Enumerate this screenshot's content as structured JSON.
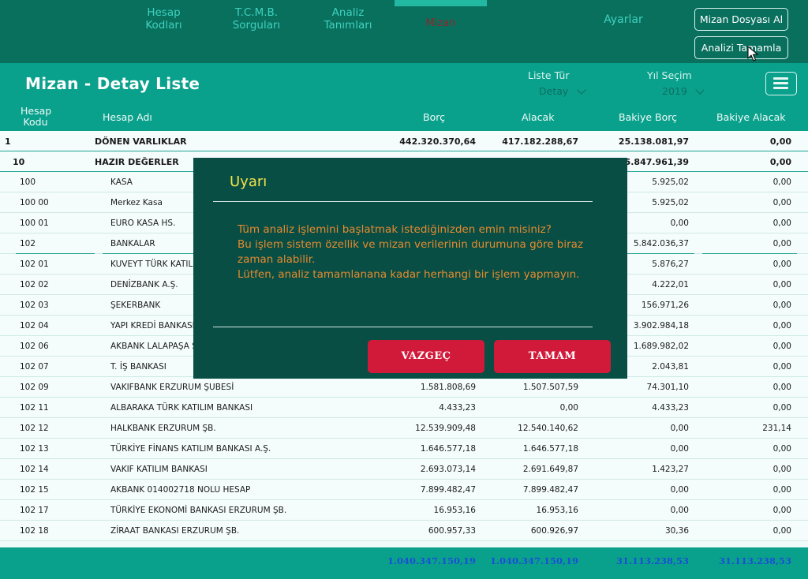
{
  "nav": {
    "items": [
      {
        "label_line1": "Hesap",
        "label_line2": "Kodları"
      },
      {
        "label_line1": "T.C.M.B.",
        "label_line2": "Sorguları"
      },
      {
        "label_line1": "Analiz",
        "label_line2": "Tanımları"
      }
    ],
    "active": "Mizan",
    "settings": "Ayarlar",
    "upload_button": "Mizan Dosyası Al",
    "complete_button": "Analizi Tamamla"
  },
  "header": {
    "title": "Mizan - Detay Liste",
    "list_type_label": "Liste Tür",
    "list_type_value": "Detay",
    "year_label": "Yıl Seçim",
    "year_value": "2019"
  },
  "columns": {
    "code": "Hesap Kodu",
    "code_l1": "Hesap",
    "code_l2": "Kodu",
    "name": "Hesap Adı",
    "debit": "Borç",
    "credit": "Alacak",
    "bal_debit": "Bakiye Borç",
    "bal_credit": "Bakiye Alacak"
  },
  "rows": [
    {
      "code": "1",
      "name": "DÖNEN VARLIKLAR",
      "debit": "442.320.370,64",
      "credit": "417.182.288,67",
      "bal_debit": "25.138.081,97",
      "bal_credit": "0,00",
      "level": 1
    },
    {
      "code": "10",
      "name": "HAZIR DEĞERLER",
      "debit": "",
      "credit": "",
      "bal_debit": "5.847.961,39",
      "bal_credit": "0,00",
      "level": 2
    },
    {
      "code": "100",
      "name": "KASA",
      "debit": "",
      "credit": "",
      "bal_debit": "5.925,02",
      "bal_credit": "0,00",
      "level": 3
    },
    {
      "code": "100 00",
      "name": "Merkez Kasa",
      "debit": "",
      "credit": "",
      "bal_debit": "5.925,02",
      "bal_credit": "0,00",
      "level": 3
    },
    {
      "code": "100 01",
      "name": "EURO KASA HS.",
      "debit": "",
      "credit": "",
      "bal_debit": "0,00",
      "bal_credit": "0,00",
      "level": 3
    },
    {
      "code": "102",
      "name": "BANKALAR",
      "debit": "",
      "credit": "",
      "bal_debit": "5.842.036,37",
      "bal_credit": "0,00",
      "level": 3,
      "underline": true
    },
    {
      "code": "102 01",
      "name": "KUVEYT TÜRK KATILIM",
      "debit": "",
      "credit": "",
      "bal_debit": "5.876,27",
      "bal_credit": "0,00",
      "level": 3
    },
    {
      "code": "102 02",
      "name": "DENİZBANK A.Ş.",
      "debit": "",
      "credit": "",
      "bal_debit": "4.222,01",
      "bal_credit": "0,00",
      "level": 3
    },
    {
      "code": "102 03",
      "name": "ŞEKERBANK",
      "debit": "",
      "credit": "",
      "bal_debit": "156.971,26",
      "bal_credit": "0,00",
      "level": 3
    },
    {
      "code": "102 04",
      "name": "YAPI KREDİ BANKASI",
      "debit": "",
      "credit": "",
      "bal_debit": "3.902.984,18",
      "bal_credit": "0,00",
      "level": 3
    },
    {
      "code": "102 06",
      "name": "AKBANK LALAPAŞA ŞB.",
      "debit": "",
      "credit": "",
      "bal_debit": "1.689.982,02",
      "bal_credit": "0,00",
      "level": 3
    },
    {
      "code": "102 07",
      "name": "T. İŞ BANKASI",
      "debit": "",
      "credit": "",
      "bal_debit": "2.043,81",
      "bal_credit": "0,00",
      "level": 3
    },
    {
      "code": "102 09",
      "name": "VAKIFBANK ERZURUM ŞUBESİ",
      "debit": "1.581.808,69",
      "credit": "1.507.507,59",
      "bal_debit": "74.301,10",
      "bal_credit": "0,00",
      "level": 3
    },
    {
      "code": "102 11",
      "name": "ALBARAKA TÜRK KATILIM BANKASI",
      "debit": "4.433,23",
      "credit": "0,00",
      "bal_debit": "4.433,23",
      "bal_credit": "0,00",
      "level": 3
    },
    {
      "code": "102 12",
      "name": "HALKBANK ERZURUM ŞB.",
      "debit": "12.539.909,48",
      "credit": "12.540.140,62",
      "bal_debit": "0,00",
      "bal_credit": "231,14",
      "level": 3
    },
    {
      "code": "102 13",
      "name": "TÜRKİYE FİNANS KATILIM BANKASI A.Ş.",
      "debit": "1.646.577,18",
      "credit": "1.646.577,18",
      "bal_debit": "0,00",
      "bal_credit": "0,00",
      "level": 3
    },
    {
      "code": "102 14",
      "name": "VAKIF KATILIM BANKASI",
      "debit": "2.693.073,14",
      "credit": "2.691.649,87",
      "bal_debit": "1.423,27",
      "bal_credit": "0,00",
      "level": 3
    },
    {
      "code": "102 15",
      "name": "AKBANK 014002718 NOLU HESAP",
      "debit": "7.899.482,47",
      "credit": "7.899.482,47",
      "bal_debit": "0,00",
      "bal_credit": "0,00",
      "level": 3
    },
    {
      "code": "102 17",
      "name": "TÜRKİYE EKONOMİ BANKASI ERZURUM ŞB.",
      "debit": "16.953,16",
      "credit": "16.953,16",
      "bal_debit": "0,00",
      "bal_credit": "0,00",
      "level": 3
    },
    {
      "code": "102 18",
      "name": "ZİRAAT BANKASI ERZURUM ŞB.",
      "debit": "600.957,33",
      "credit": "600.926,97",
      "bal_debit": "30,36",
      "bal_credit": "0,00",
      "level": 3
    }
  ],
  "totals": {
    "debit": "1.040.347.150,19",
    "credit": "1.040.347.150,19",
    "bal_debit": "31.113.238,53",
    "bal_credit": "31.113.238,53"
  },
  "modal": {
    "title": "Uyarı",
    "line1": "Tüm analiz işlemini başlatmak istediğinizden emin misiniz?",
    "line2": "Bu işlem sistem özellik ve mizan verilerinin durumuna göre biraz zaman alabilir.",
    "line3": "Lütfen, analiz tamamlanana kadar herhangi bir işlem yapmayın.",
    "cancel": "VAZGEÇ",
    "ok": "TAMAM"
  },
  "colors": {
    "nav_bg": "#09705e",
    "header_bg": "#0aa18c",
    "modal_bg": "#084e45",
    "modal_title": "#f2e24a",
    "modal_text": "#e68a2e",
    "button_red": "#d11a3a",
    "total_blue": "#1a4fd6"
  },
  "icons": {
    "menu": "hamburger-menu-icon",
    "dropdown": "chevron-down-icon",
    "cursor": "mouse-pointer-icon"
  }
}
